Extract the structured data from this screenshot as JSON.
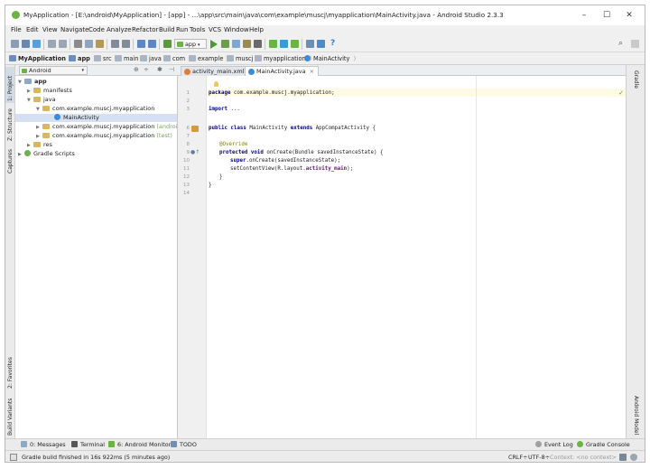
{
  "window": {
    "title": "MyApplication - [E:\\android\\MyApplication] - [app] - ...\\app\\src\\main\\java\\com\\example\\muscj\\myapplication\\MainActivity.java - Android Studio 2.3.3",
    "controls": {
      "minimize": "–",
      "maximize": "☐",
      "close": "✕"
    }
  },
  "menu": [
    "File",
    "Edit",
    "View",
    "Navigate",
    "Code",
    "Analyze",
    "Refactor",
    "Build",
    "Run",
    "Tools",
    "VCS",
    "Window",
    "Help"
  ],
  "toolbar": {
    "run_config": "app"
  },
  "breadcrumbs": [
    "MyApplication",
    "app",
    "src",
    "main",
    "java",
    "com",
    "example",
    "muscj",
    "myapplication",
    "MainActivity"
  ],
  "left_strip": {
    "project": "1: Project",
    "structure": "Z: Structure",
    "captures": "Captures",
    "favorites": "2: Favorites",
    "build_variants": "Build Variants"
  },
  "right_strip": {
    "gradle": "Gradle",
    "android_model": "Android Model"
  },
  "project_panel": {
    "view_selector": "Android",
    "tree": [
      {
        "label": "app",
        "hint": ""
      },
      {
        "label": "manifests",
        "hint": ""
      },
      {
        "label": "java",
        "hint": ""
      },
      {
        "label": "com.example.muscj.myapplication",
        "hint": ""
      },
      {
        "label": "MainActivity",
        "hint": ""
      },
      {
        "label": "com.example.muscj.myapplication",
        "hint": "(androidTest)"
      },
      {
        "label": "com.example.muscj.myapplication",
        "hint": "(test)"
      },
      {
        "label": "res",
        "hint": ""
      },
      {
        "label": "Gradle Scripts",
        "hint": ""
      }
    ]
  },
  "editor": {
    "tabs": [
      {
        "label": "activity_main.xml",
        "close": "×"
      },
      {
        "label": "MainActivity.java",
        "close": "×"
      }
    ],
    "line_numbers": [
      "1",
      "2",
      "3",
      "6",
      "7",
      "8",
      "9",
      "10",
      "11",
      "12",
      "13",
      "14"
    ],
    "code": {
      "l1_kw": "package",
      "l1_rest": " com.example.muscj.myapplication;",
      "l3_kw": "import",
      "l3_rest": " ...",
      "l6_kw1": "public class",
      "l6_mid": " MainActivity ",
      "l6_kw2": "extends",
      "l6_rest": " AppCompatActivity {",
      "l8_an": "@Override",
      "l9_kw": "protected void",
      "l9_rest": " onCreate(Bundle savedInstanceState) {",
      "l10_kw": "super",
      "l10_rest": ".onCreate(savedInstanceState);",
      "l11_pre": "setContentView(R.layout.",
      "l11_pu": "activity_main",
      "l11_post": ");",
      "l12": "}",
      "l13": "}"
    }
  },
  "bottom_tabs": [
    "0: Messages",
    "Terminal",
    "6: Android Monitor",
    "TODO"
  ],
  "bottom_right_tabs": [
    "Event Log",
    "Gradle Console"
  ],
  "status": {
    "message": "Gradle build finished in 16s 922ms (5 minutes ago)",
    "line_sep": "CRLF÷",
    "encoding": "UTF-8÷",
    "context": "Context: <no context>"
  },
  "colors": {
    "android_green": "#6ab344",
    "keyword": "#000080",
    "annotation": "#808000",
    "field": "#660e7a"
  }
}
